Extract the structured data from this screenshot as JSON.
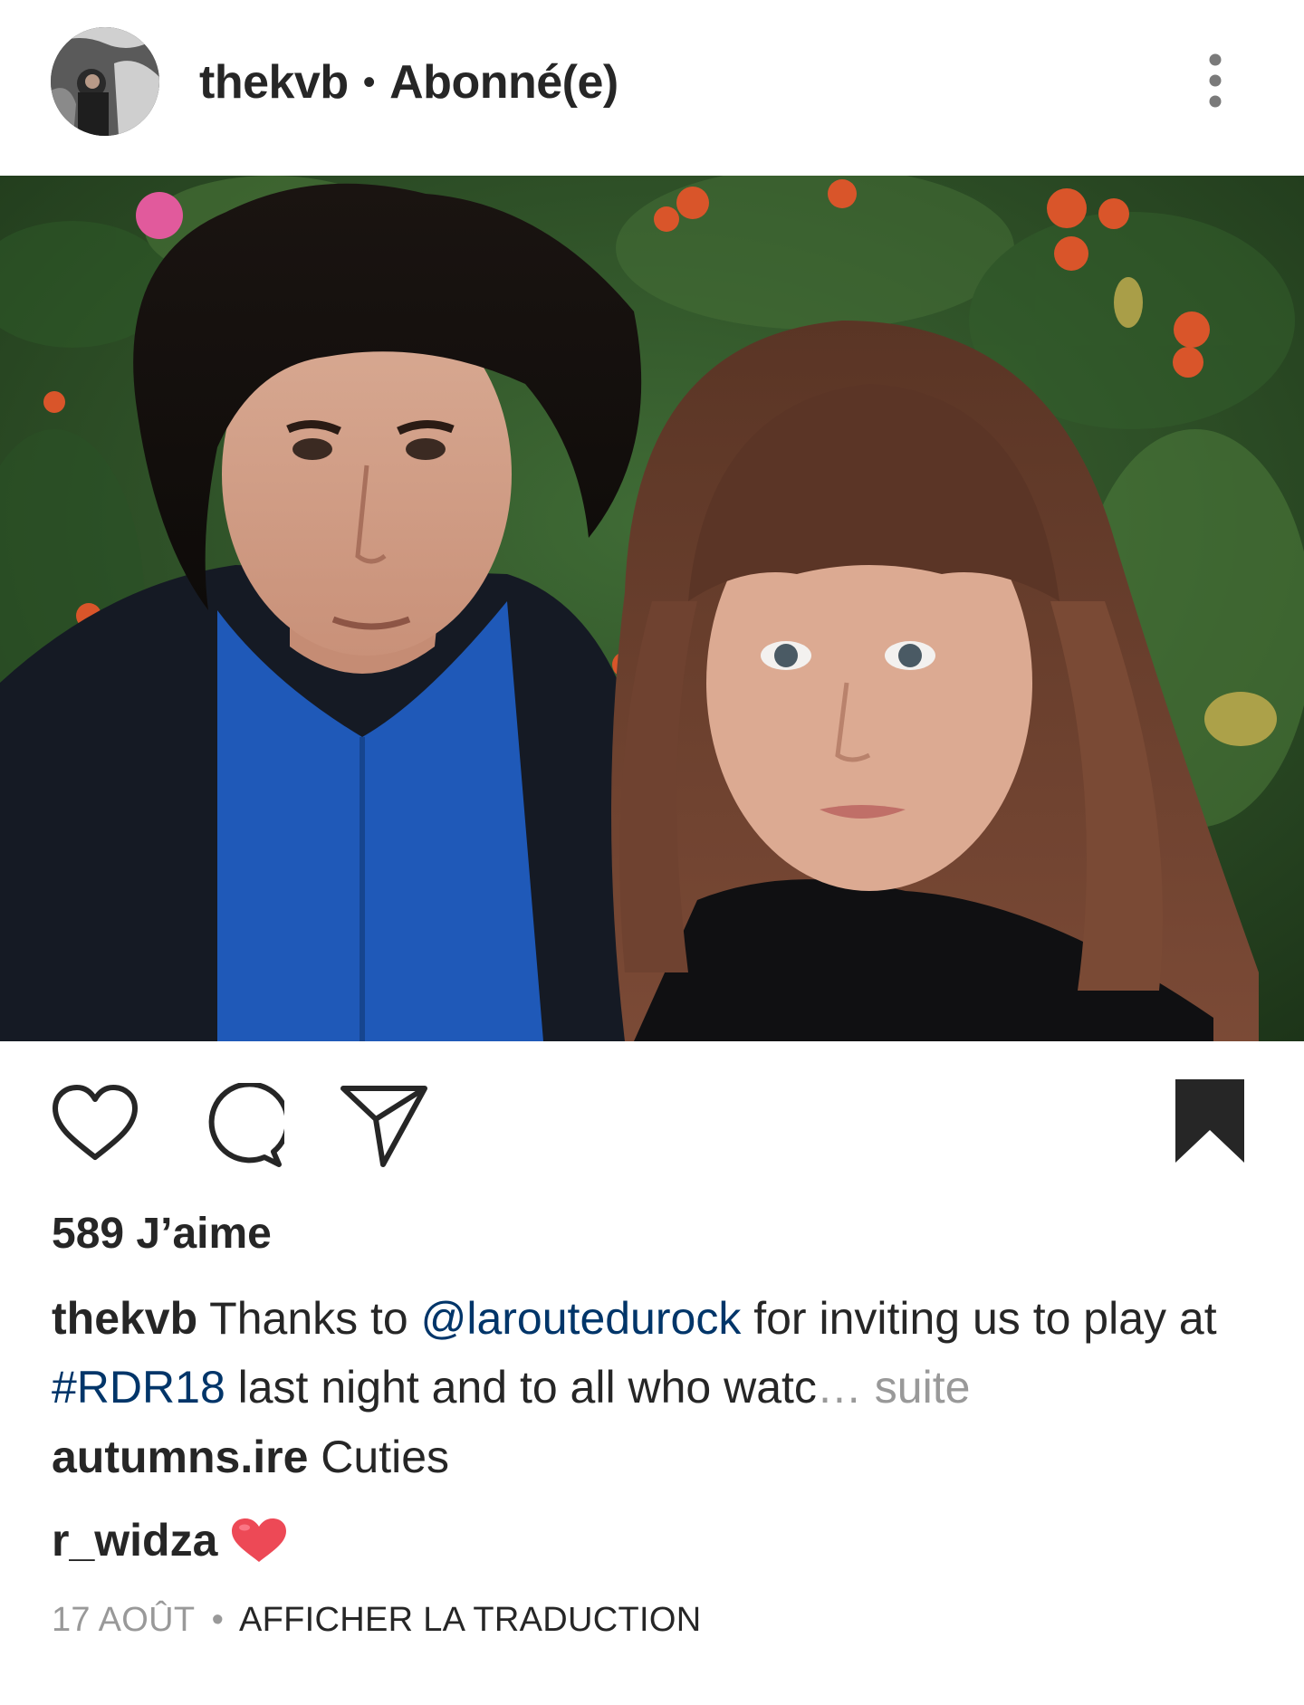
{
  "post": {
    "username": "thekvb",
    "separator": "•",
    "follow_status": "Abonné(e)"
  },
  "icons": {
    "avatar": "avatar",
    "more": "more-vertical-icon",
    "like": "heart-icon",
    "comment": "comment-icon",
    "share": "send-icon",
    "save": "bookmark-icon",
    "emoji": "red-heart-emoji"
  },
  "likes": {
    "count_label": "589 J’aime"
  },
  "caption": {
    "username": "thekvb",
    "text_before": " Thanks to ",
    "mention": "@laroutedurock",
    "text_middle": " for inviting us to play at ",
    "hashtag": "#RDR18",
    "text_after": " last night and to all who watc",
    "ellipsis": "…",
    "more_label": " suite"
  },
  "comments": [
    {
      "username": "autumns.ire",
      "text": " Cuties"
    },
    {
      "username": "r_widza",
      "text": ""
    }
  ],
  "meta": {
    "date": "17 AOÛT",
    "separator": "•",
    "translate_label": "AFFICHER LA TRADUCTION"
  },
  "colors": {
    "text": "#262626",
    "link": "#003569",
    "muted": "#999999",
    "emoji_heart": "#ed4956"
  }
}
